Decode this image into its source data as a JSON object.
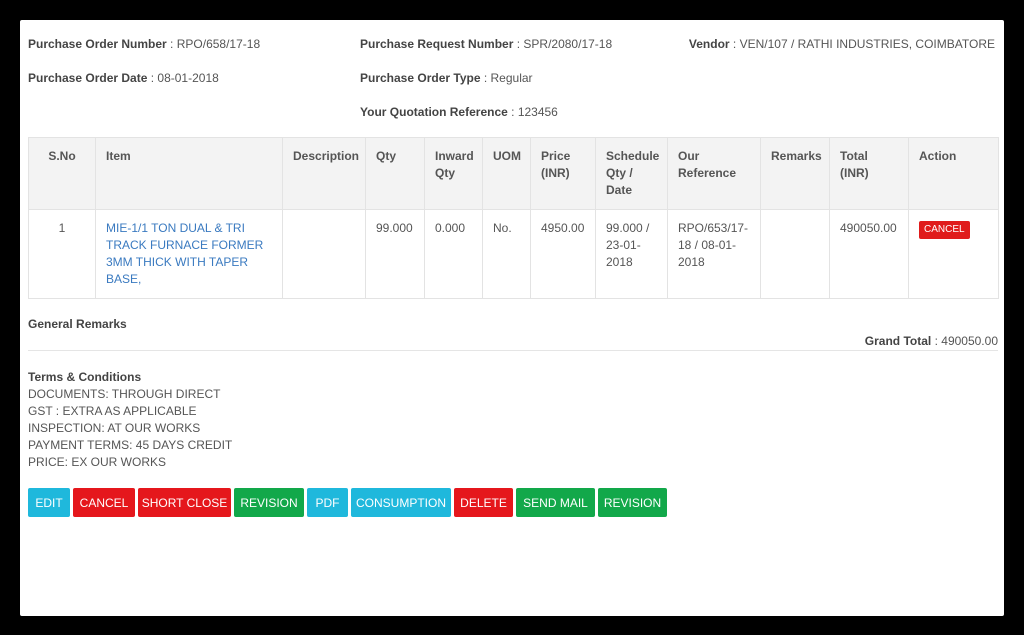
{
  "header": {
    "po_number_label": "Purchase Order Number",
    "po_number_value": "RPO/658/17-18",
    "pr_number_label": "Purchase Request Number",
    "pr_number_value": "SPR/2080/17-18",
    "vendor_label": "Vendor",
    "vendor_value": "VEN/107 / RATHI INDUSTRIES, COIMBATORE",
    "po_date_label": "Purchase Order Date",
    "po_date_value": "08-01-2018",
    "po_type_label": "Purchase Order Type",
    "po_type_value": "Regular",
    "quotation_label": "Your Quotation Reference",
    "quotation_value": "123456",
    "separator": " : "
  },
  "table": {
    "columns": [
      "S.No",
      "Item",
      "Description",
      "Qty",
      "Inward Qty",
      "UOM",
      "Price (INR)",
      "Schedule Qty / Date",
      "Our Reference",
      "Remarks",
      "Total (INR)",
      "Action"
    ],
    "rows": [
      {
        "sno": "1",
        "item": "MIE-1/1 TON DUAL & TRI TRACK FURNACE FORMER 3MM THICK WITH TAPER BASE,",
        "description": "",
        "qty": "99.000",
        "inward_qty": "0.000",
        "uom": "No.",
        "price": "4950.00",
        "schedule": "99.000 / 23-01-2018",
        "reference": "RPO/653/17-18 / 08-01-2018",
        "remarks": "",
        "total": "490050.00",
        "action_label": "CANCEL"
      }
    ]
  },
  "remarks": {
    "general_remarks_label": "General Remarks",
    "grand_total_label": "Grand Total",
    "grand_total_value": "490050.00"
  },
  "terms": {
    "title": "Terms & Conditions",
    "lines": [
      "DOCUMENTS: THROUGH DIRECT",
      "GST : EXTRA AS APPLICABLE",
      "INSPECTION: AT OUR WORKS",
      "PAYMENT TERMS: 45 DAYS CREDIT",
      "PRICE: EX OUR WORKS"
    ]
  },
  "buttons": {
    "edit": "EDIT",
    "cancel": "CANCEL",
    "short_close": "SHORT CLOSE",
    "revision": "REVISION",
    "pdf": "PDF",
    "consumption": "CONSUMPTION",
    "delete": "DELETE",
    "send_mail": "SEND MAIL",
    "revision2": "REVISION"
  },
  "colors": {
    "cyan": "#1fb8dc",
    "red": "#e5171c",
    "green": "#12a84a",
    "link": "#3a7ac0"
  }
}
